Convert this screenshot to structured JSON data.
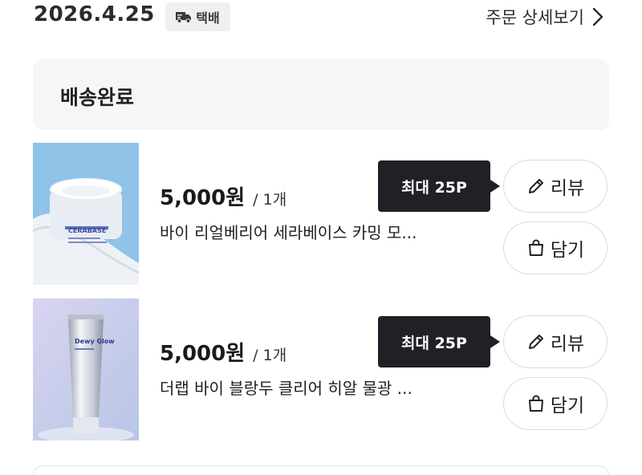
{
  "order": {
    "date": "2026.4.25",
    "shipping_label": "택배",
    "detail_link": "주문 상세보기"
  },
  "status": {
    "text": "배송완료"
  },
  "items": [
    {
      "price": "5,000원",
      "qty": "/ 1개",
      "name": "바이 리얼베리어 세라베이스 카밍 모...",
      "tooltip": "최대 25P",
      "review_label": "리뷰",
      "cart_label": "담기",
      "product_text": "CERABASE"
    },
    {
      "price": "5,000원",
      "qty": "/ 1개",
      "name": "더랩 바이 블랑두 클리어 히알 물광 ...",
      "tooltip": "최대 25P",
      "review_label": "리뷰",
      "cart_label": "담기",
      "product_text": "Dewy Glow"
    }
  ],
  "colors": {
    "tooltip_bg": "#1f2126",
    "status_bg": "#f5f6f8",
    "chip_bg": "#eef0f2",
    "button_border": "#d9dbe0"
  },
  "icons": [
    "truck-icon",
    "chevron-right-icon",
    "pencil-icon",
    "shopping-bag-icon"
  ]
}
